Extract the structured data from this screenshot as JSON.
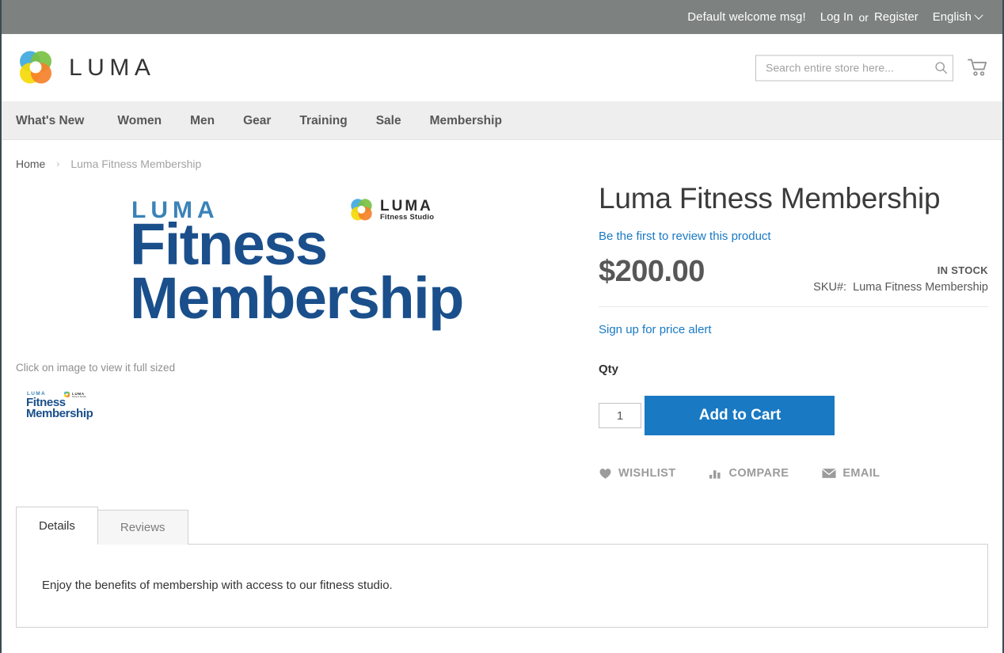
{
  "top_panel": {
    "welcome": "Default welcome msg!",
    "log_in": "Log In",
    "or": "or",
    "register": "Register",
    "language": "English"
  },
  "header": {
    "logo_text": "LUMA",
    "logo_icon": "luma-flower-logo",
    "search": {
      "placeholder": "Search entire store here...",
      "value": "",
      "icon": "search-icon"
    },
    "cart_icon": "shopping-cart-icon"
  },
  "nav": {
    "items": [
      {
        "label": "What's New"
      },
      {
        "label": "Women"
      },
      {
        "label": "Men"
      },
      {
        "label": "Gear"
      },
      {
        "label": "Training"
      },
      {
        "label": "Sale"
      },
      {
        "label": "Membership"
      }
    ]
  },
  "breadcrumbs": {
    "home": "Home",
    "separator": "›",
    "current": "Luma Fitness Membership"
  },
  "media": {
    "image": {
      "brand_word": "LUMA",
      "line1": "Fitness",
      "line2": "Membership",
      "studio_word": "LUMA",
      "studio_sub": "Fitness Studio"
    },
    "note": "Click on image to view it full sized",
    "thumbnail_alt": "Luma Fitness Membership thumbnail"
  },
  "product": {
    "title": "Luma Fitness Membership",
    "review_link": "Be the first to review this product",
    "price": "$200.00",
    "stock_status": "IN STOCK",
    "sku_label": "SKU#:",
    "sku_value": "Luma Fitness Membership",
    "price_alert": "Sign up for price alert",
    "qty_label": "Qty",
    "qty_value": "1",
    "add_to_cart": "Add to Cart",
    "social": [
      {
        "label": "WISHLIST",
        "icon": "heart-icon"
      },
      {
        "label": "COMPARE",
        "icon": "compare-bars-icon"
      },
      {
        "label": "EMAIL",
        "icon": "envelope-icon"
      }
    ]
  },
  "tabs": {
    "items": [
      {
        "label": "Details",
        "active": true
      },
      {
        "label": "Reviews",
        "active": false
      }
    ],
    "details_text": "Enjoy the benefits of membership with access to our fitness studio."
  },
  "colors": {
    "accent_blue": "#1979c3",
    "link_blue": "#1979c3",
    "top_bar_gray": "#7d8180",
    "nav_gray": "#eeeeee",
    "title_gray": "#3b3b3b",
    "image_navy": "#1a4f8b",
    "image_light_blue": "#3a83b8"
  }
}
